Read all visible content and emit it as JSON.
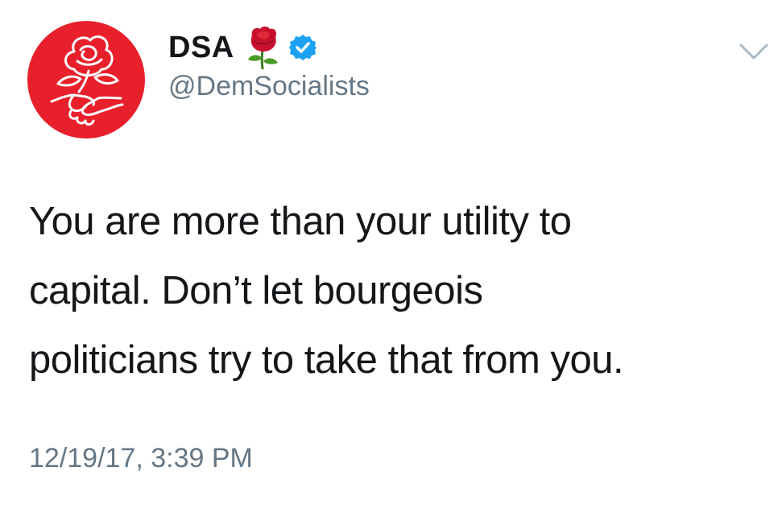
{
  "tweet": {
    "author": {
      "display_name": "DSA",
      "handle": "@DemSocialists",
      "avatar_icon": "dsa-rose-handshake-logo",
      "avatar_color": "#e8202b",
      "name_emoji": "rose-icon",
      "verified": true,
      "verified_color": "#1da1f2"
    },
    "text_lines": [
      "You are more than your utility to",
      "capital. Don’t let bourgeois",
      "politicians try to take that from you."
    ],
    "timestamp": "12/19/17, 3:39 PM",
    "menu_icon": "chevron-down-icon"
  }
}
